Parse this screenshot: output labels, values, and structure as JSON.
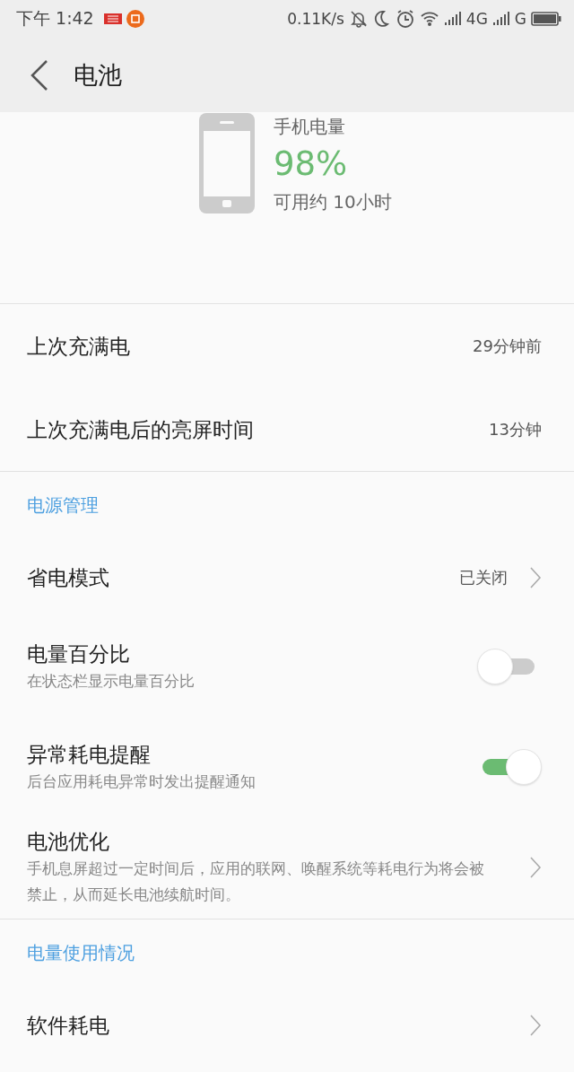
{
  "status_bar": {
    "time": "下午 1:42",
    "speed": "0.11K/s",
    "network_1": "4G",
    "network_2": "G"
  },
  "header": {
    "title": "电池"
  },
  "battery": {
    "label": "手机电量",
    "percent": "98%",
    "remaining": "可用约 10小时"
  },
  "groups": [
    {
      "kind": "plain",
      "items": [
        {
          "kind": "info",
          "label": "上次充满电",
          "value": "29分钟前"
        },
        {
          "kind": "info",
          "label": "上次充满电后的亮屏时间",
          "value": "13分钟"
        }
      ]
    },
    {
      "kind": "section",
      "title": "电源管理",
      "items": [
        {
          "kind": "nav",
          "label": "省电模式",
          "value": "已关闭"
        },
        {
          "kind": "toggle",
          "label": "电量百分比",
          "subtitle": "在状态栏显示电量百分比",
          "on": false
        },
        {
          "kind": "toggle",
          "label": "异常耗电提醒",
          "subtitle": "后台应用耗电异常时发出提醒通知",
          "on": true
        },
        {
          "kind": "nav",
          "label": "电池优化",
          "subtitle": "手机息屏超过一定时间后，应用的联网、唤醒系统等耗电行为将会被禁止，从而延长电池续航时间。"
        }
      ]
    },
    {
      "kind": "section",
      "title": "电量使用情况",
      "items": [
        {
          "kind": "nav",
          "label": "软件耗电"
        }
      ]
    }
  ]
}
